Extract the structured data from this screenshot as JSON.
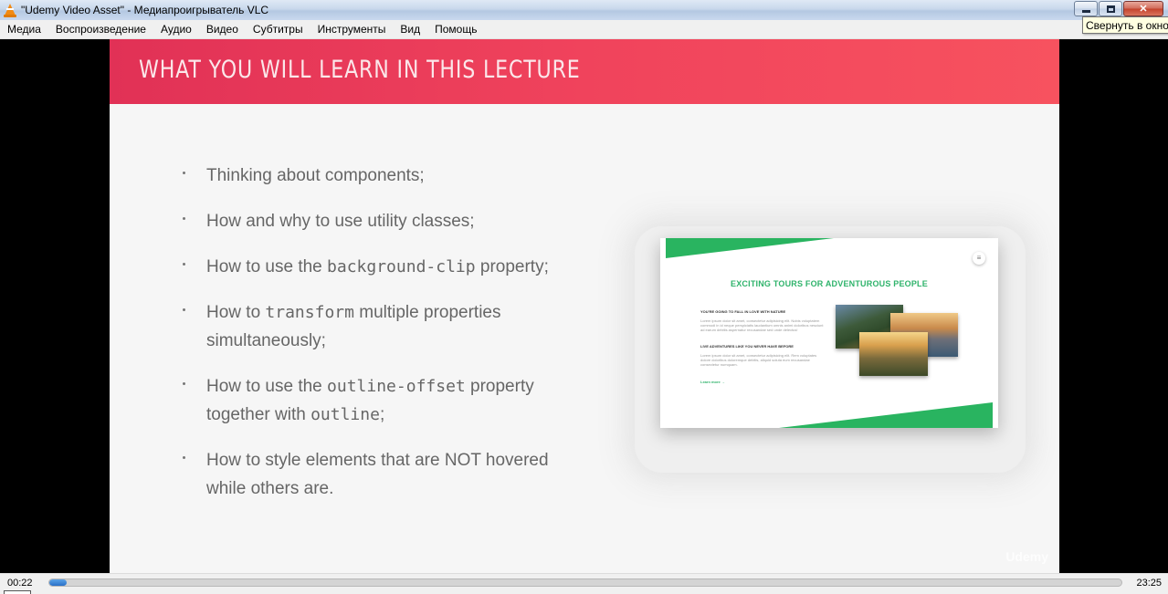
{
  "window": {
    "title": "\"Udemy Video Asset\" - Медиапроигрыватель VLC",
    "tooltip": "Свернуть в окно",
    "close_label": "✕"
  },
  "menu": {
    "items": [
      "Медиа",
      "Воспроизведение",
      "Аудио",
      "Видео",
      "Субтитры",
      "Инструменты",
      "Вид",
      "Помощь"
    ]
  },
  "slide": {
    "title": "WHAT YOU WILL LEARN IN THIS LECTURE",
    "bullets": [
      {
        "parts": [
          {
            "t": "Thinking about components;",
            "code": false
          }
        ]
      },
      {
        "parts": [
          {
            "t": "How and why to use utility classes;",
            "code": false
          }
        ]
      },
      {
        "parts": [
          {
            "t": "How to use the ",
            "code": false
          },
          {
            "t": "background-clip",
            "code": true
          },
          {
            "t": " property;",
            "code": false
          }
        ]
      },
      {
        "parts": [
          {
            "t": "How to ",
            "code": false
          },
          {
            "t": "transform",
            "code": true
          },
          {
            "t": " multiple properties simultaneously;",
            "code": false
          }
        ]
      },
      {
        "parts": [
          {
            "t": "How to use the ",
            "code": false
          },
          {
            "t": "outline-offset",
            "code": true
          },
          {
            "t": " property together with ",
            "code": false
          },
          {
            "t": "outline",
            "code": true
          },
          {
            "t": ";",
            "code": false
          }
        ]
      },
      {
        "parts": [
          {
            "t": "How to style elements that are NOT hovered while others are.",
            "code": false
          }
        ]
      }
    ],
    "thumbnail": {
      "heading": "EXCITING TOURS FOR ADVENTUROUS PEOPLE",
      "sub1": "YOU'RE GOING TO FALL IN LOVE WITH NATURE",
      "para1": "Lorem ipsum dolor sit amet, consectetur adipisicing elit. Nobis voluptatem commodi in id neque perspiciatis laudantium omnis animi doloribus nesciunt ad earum debitis aspernatur recusandae sed unde delectus!",
      "sub2": "LIVE ADVENTURES LIKE YOU NEVER HAVE BEFORE",
      "para2": "Lorem ipsum dolor sit amet, consectetur adipisicing elit. Rem voluptates dolore doloribus doloremque debitis, aliquid soluta eum recusandae consectetur numquam.",
      "link": "Learn more →"
    },
    "watermark": "Udemy"
  },
  "player": {
    "current_time": "00:22",
    "total_time": "23:25",
    "progress": 0.016
  },
  "colors": {
    "header_start": "#e13156",
    "header_end": "#f7525f",
    "accent_green": "#2fb36b",
    "seek_fill": "#2a6fc7"
  }
}
